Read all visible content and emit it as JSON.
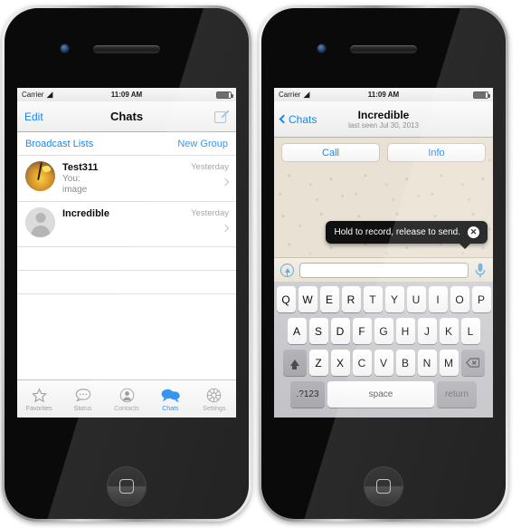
{
  "left_phone": {
    "status_bar": {
      "carrier": "Carrier",
      "wifi_icon": "wifi-icon",
      "time": "11:09 AM",
      "battery_icon": "battery-icon"
    },
    "navbar": {
      "left_button": "Edit",
      "title": "Chats",
      "right_icon": "compose-icon"
    },
    "quick_links": {
      "broadcast": "Broadcast Lists",
      "new_group": "New Group"
    },
    "chats": [
      {
        "name": "Test311",
        "line1": "You:",
        "line2": "image",
        "time": "Yesterday",
        "avatar": "cocktail-photo-avatar"
      },
      {
        "name": "Incredible",
        "line1": "",
        "line2": "",
        "time": "Yesterday",
        "avatar": "default-person-avatar"
      }
    ],
    "tabs": [
      {
        "label": "Favorites",
        "icon": "star-icon",
        "active": false
      },
      {
        "label": "Status",
        "icon": "speech-bubble-dots-icon",
        "active": false
      },
      {
        "label": "Contacts",
        "icon": "person-circle-icon",
        "active": false
      },
      {
        "label": "Chats",
        "icon": "chat-bubbles-icon",
        "active": true
      },
      {
        "label": "Settings",
        "icon": "gear-icon",
        "active": false
      }
    ]
  },
  "right_phone": {
    "status_bar": {
      "carrier": "Carrier",
      "wifi_icon": "wifi-icon",
      "time": "11:09 AM",
      "battery_icon": "battery-icon"
    },
    "navbar": {
      "back_label": "Chats",
      "title": "Incredible",
      "subtitle": "last seen Jul 30, 2013"
    },
    "actions": {
      "call": "Call",
      "info": "Info"
    },
    "tooltip": {
      "text": "Hold to record, release to send.",
      "close_icon": "close-icon"
    },
    "input_row": {
      "attach_icon": "attach-arrow-icon",
      "field_value": "",
      "field_placeholder": "",
      "mic_icon": "microphone-icon"
    },
    "keyboard": {
      "row1": [
        "Q",
        "W",
        "E",
        "R",
        "T",
        "Y",
        "U",
        "I",
        "O",
        "P"
      ],
      "row2": [
        "A",
        "S",
        "D",
        "F",
        "G",
        "H",
        "J",
        "K",
        "L"
      ],
      "row3": [
        "Z",
        "X",
        "C",
        "V",
        "B",
        "N",
        "M"
      ],
      "shift_icon": "shift-arrow-icon",
      "delete_icon": "backspace-icon",
      "numeric_key": ".?123",
      "space_key": "space",
      "return_key": "return"
    }
  },
  "colors": {
    "ios_blue": "#1b87f0",
    "wallpaper": "#e9e1d3",
    "tooltip_bg": "#101010"
  }
}
